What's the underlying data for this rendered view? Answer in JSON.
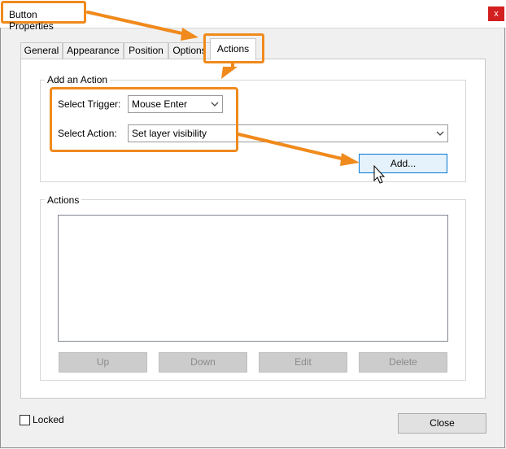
{
  "window": {
    "title": "Button Properties",
    "close_label": "x"
  },
  "tabs": [
    {
      "label": "General"
    },
    {
      "label": "Appearance"
    },
    {
      "label": "Position"
    },
    {
      "label": "Options"
    },
    {
      "label": "Actions",
      "active": true
    }
  ],
  "add_action": {
    "group_label": "Add an Action",
    "trigger_label": "Select Trigger:",
    "trigger_value": "Mouse Enter",
    "action_label": "Select Action:",
    "action_value": "Set layer visibility",
    "add_button": "Add..."
  },
  "actions_group": {
    "label": "Actions",
    "items": [],
    "buttons": {
      "up": "Up",
      "down": "Down",
      "edit": "Edit",
      "delete": "Delete"
    }
  },
  "footer": {
    "locked_label": "Locked",
    "locked_checked": false,
    "close_button": "Close"
  },
  "colors": {
    "annotation_orange": "#f08a1c",
    "close_red": "#d21f1f",
    "add_button_border": "#0078d7"
  }
}
